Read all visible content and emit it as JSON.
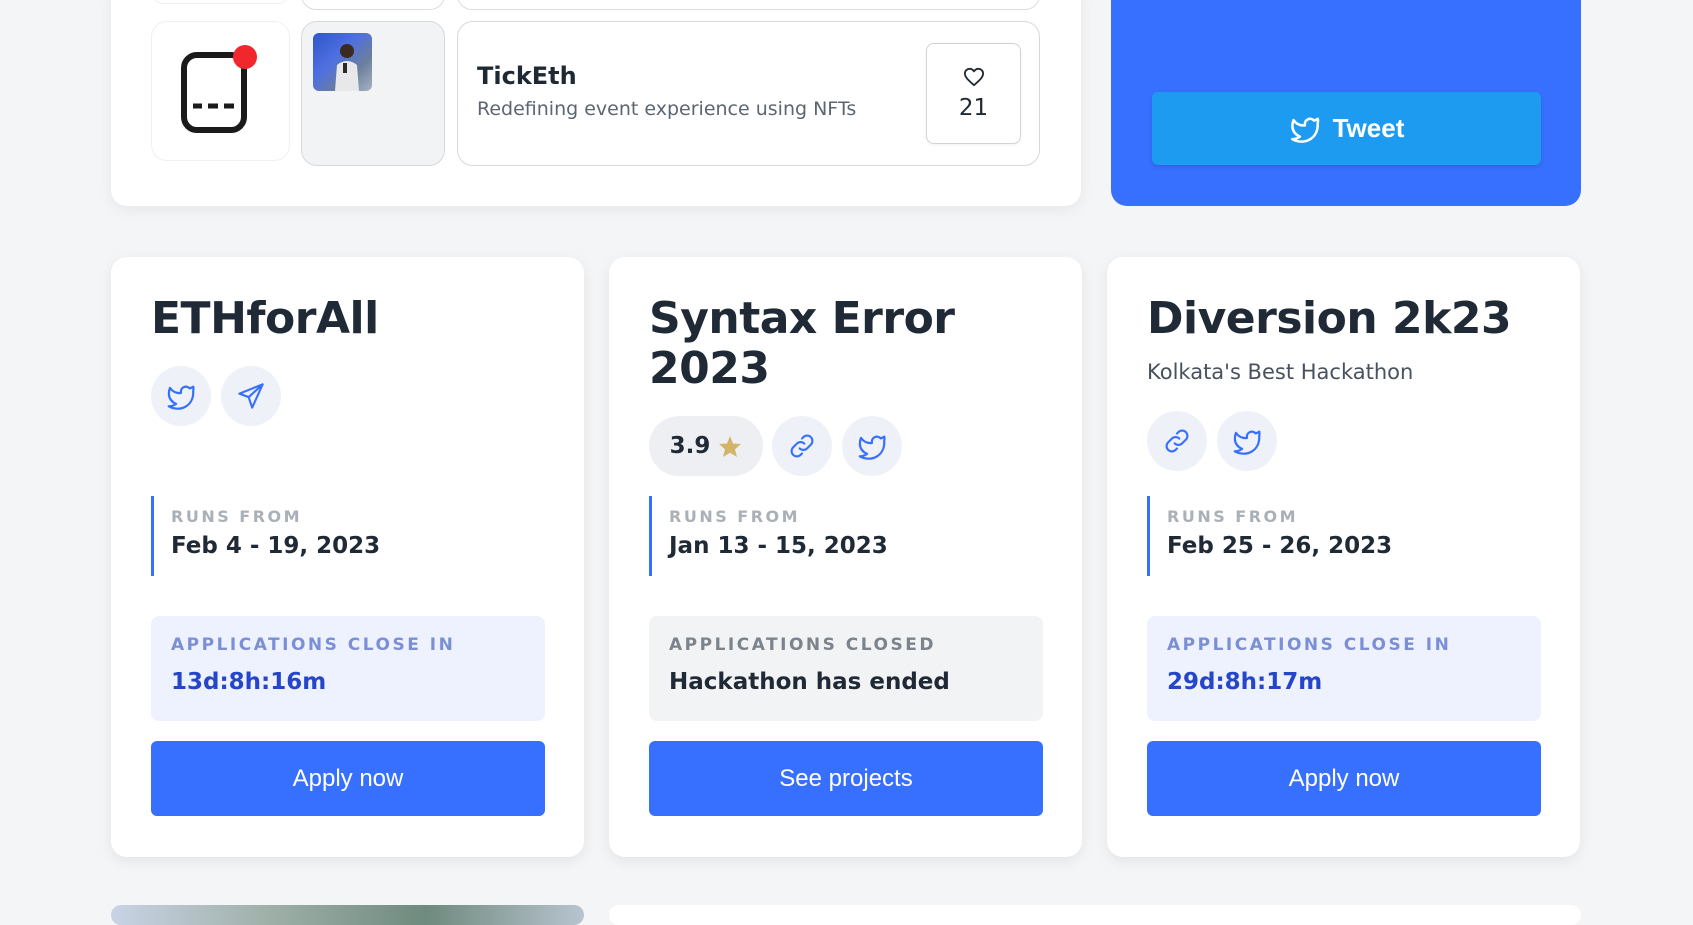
{
  "project": {
    "name": "TickEth",
    "description": "Redefining event experience using NFTs",
    "likes": "21"
  },
  "tweet_label": "Tweet",
  "hackathons": [
    {
      "title_lines": [
        "ETHforAll"
      ],
      "tagline": "",
      "runs_label": "RUNS FROM",
      "dates": "Feb 4 - 19, 2023",
      "status_label": "APPLICATIONS CLOSE IN",
      "status_value": "13d:8h:16m",
      "cta": "Apply now"
    },
    {
      "title_lines": [
        "Syntax Error",
        "2023"
      ],
      "tagline": "",
      "rating": "3.9",
      "runs_label": "RUNS FROM",
      "dates": "Jan 13 - 15, 2023",
      "status_label": "APPLICATIONS CLOSED",
      "status_value": "Hackathon has ended",
      "cta": "See projects"
    },
    {
      "title_lines": [
        "Diversion 2k23"
      ],
      "tagline": "Kolkata's Best Hackathon",
      "runs_label": "RUNS FROM",
      "dates": "Feb 25 - 26, 2023",
      "status_label": "APPLICATIONS CLOSE IN",
      "status_value": "29d:8h:17m",
      "cta": "Apply now"
    }
  ],
  "colors": {
    "primary": "#3770ff",
    "twitter": "#1d9bf0",
    "page_bg": "#f4f5f6",
    "status_open_bg": "#eef2ff",
    "star": "#d4b46a",
    "notification_dot": "#f0282d"
  },
  "icons": [
    "heart-icon",
    "twitter-icon",
    "telegram-icon",
    "link-icon",
    "star-icon"
  ]
}
